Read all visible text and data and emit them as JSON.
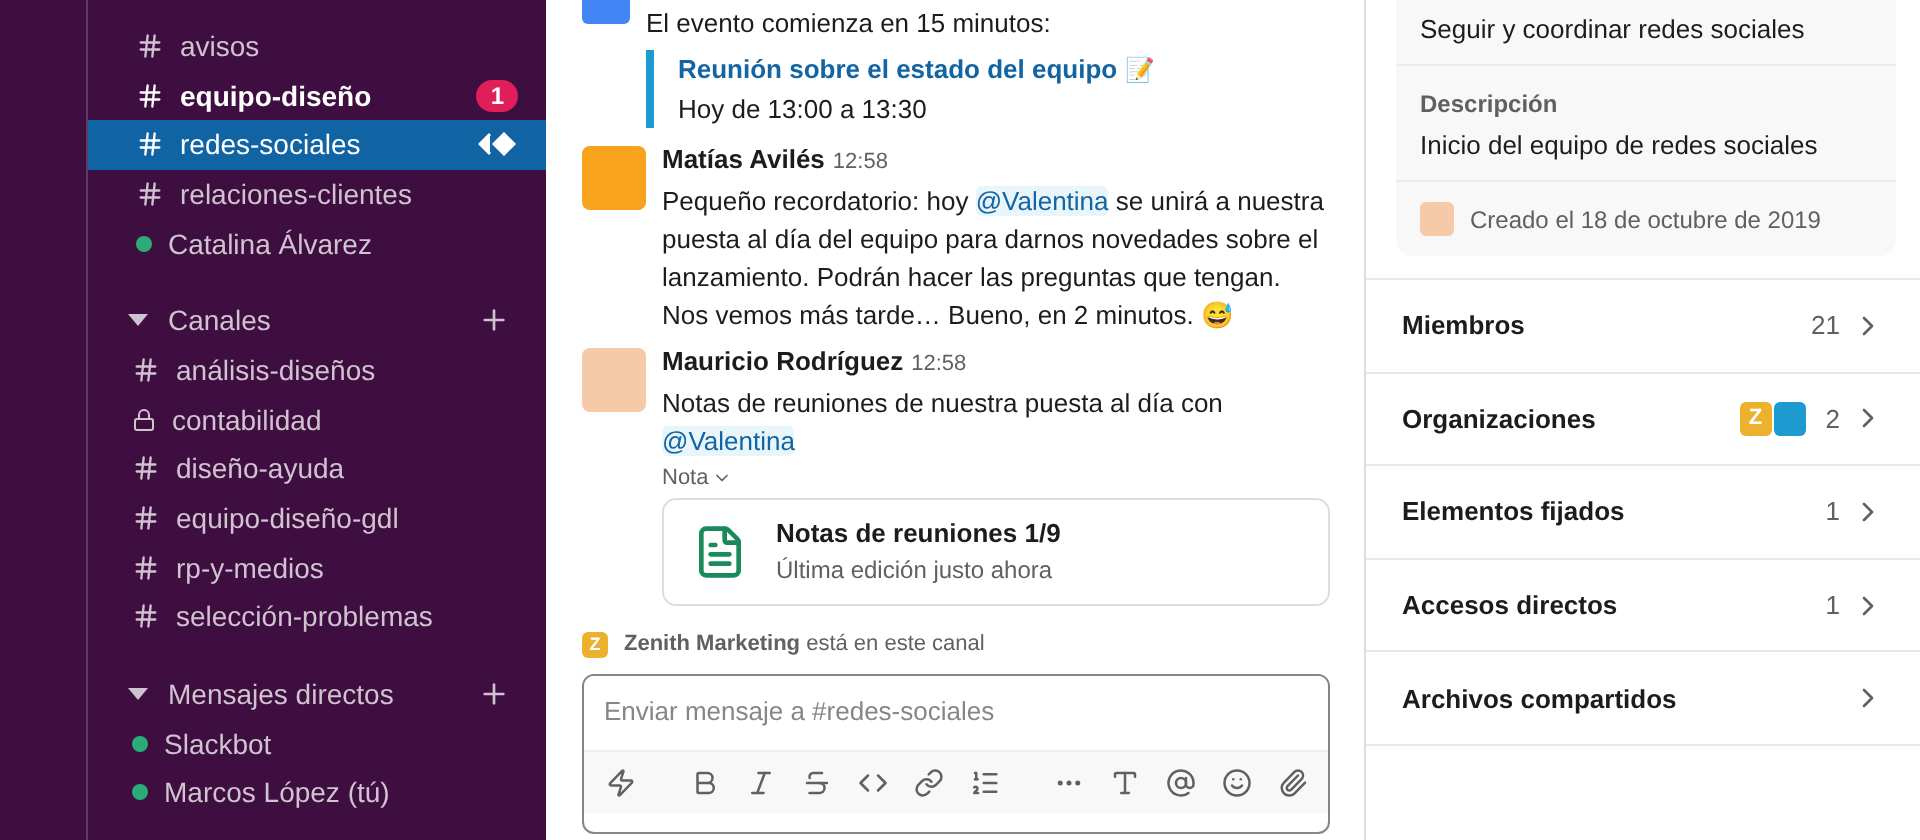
{
  "sidebar": {
    "favorites": [
      {
        "kind": "channel",
        "label": "avisos",
        "unread": false,
        "selected": false
      },
      {
        "kind": "channel",
        "label": "equipo-diseño",
        "unread": true,
        "badge": "1",
        "selected": false
      },
      {
        "kind": "channel",
        "label": "redes-sociales",
        "unread": false,
        "selected": true
      },
      {
        "kind": "channel",
        "label": "relaciones-clientes",
        "unread": false,
        "selected": false
      },
      {
        "kind": "person",
        "label": "Catalina Álvarez",
        "unread": false,
        "selected": false
      }
    ],
    "sections": [
      {
        "title": "Canales",
        "items": [
          {
            "kind": "channel",
            "label": "análisis-diseños",
            "selected": false
          },
          {
            "kind": "private",
            "label": "contabilidad",
            "selected": false
          },
          {
            "kind": "channel",
            "label": "diseño-ayuda",
            "selected": false
          },
          {
            "kind": "channel",
            "label": "equipo-diseño-gdl",
            "selected": false
          },
          {
            "kind": "channel",
            "label": "rp-y-medios",
            "selected": false
          },
          {
            "kind": "channel",
            "label": "selección-problemas",
            "selected": false
          }
        ]
      },
      {
        "title": "Mensajes directos",
        "items": [
          {
            "kind": "person",
            "label": "Slackbot",
            "selected": false
          },
          {
            "kind": "person",
            "label": "Marcos López (tú)",
            "selected": false
          }
        ]
      }
    ]
  },
  "messages": [
    {
      "kind": "event",
      "text": "El evento comienza en 15 minutos:",
      "event_title": "Reunión sobre el estado del equipo",
      "event_emoji": "📝",
      "event_time": "Hoy de 13:00 a 13:30"
    },
    {
      "kind": "user",
      "author": "Matías Avilés",
      "time": "12:58",
      "parts": [
        "Pequeño recordatorio: hoy ",
        "@Valentina",
        " se unirá a nuestra puesta al día del equipo para darnos novedades sobre el lanzamiento. Podrán hacer las preguntas que tengan. Nos vemos más tarde… Bueno, en 2 minutos. 😅"
      ]
    },
    {
      "kind": "user",
      "author": "Mauricio Rodríguez",
      "time": "12:58",
      "parts": [
        "Notas de reuniones de nuestra puesta al día con ",
        "@Valentina"
      ],
      "attachment": {
        "label": "Nota",
        "title": "Notas de reuniones 1/9",
        "subtitle": "Última edición justo ahora"
      }
    }
  ],
  "channel_notice": {
    "badge": "Z",
    "name": "Zenith Marketing",
    "text": " está en este canal"
  },
  "composer": {
    "placeholder": "Enviar mensaje a #redes-sociales"
  },
  "details": {
    "topic": "Seguir y coordinar redes sociales",
    "description_label": "Descripción",
    "description": "Inicio del equipo de redes sociales",
    "created": "Creado el 18 de octubre de 2019",
    "rows": [
      {
        "label": "Miembros",
        "count": "21"
      },
      {
        "label": "Organizaciones",
        "count": "2",
        "orgs": [
          {
            "badge": "Z",
            "color": "#ecb22e"
          },
          {
            "color": "#1d9bd1"
          }
        ]
      },
      {
        "label": "Elementos fijados",
        "count": "1"
      },
      {
        "label": "Accesos directos",
        "count": "1"
      },
      {
        "label": "Archivos compartidos"
      }
    ]
  }
}
